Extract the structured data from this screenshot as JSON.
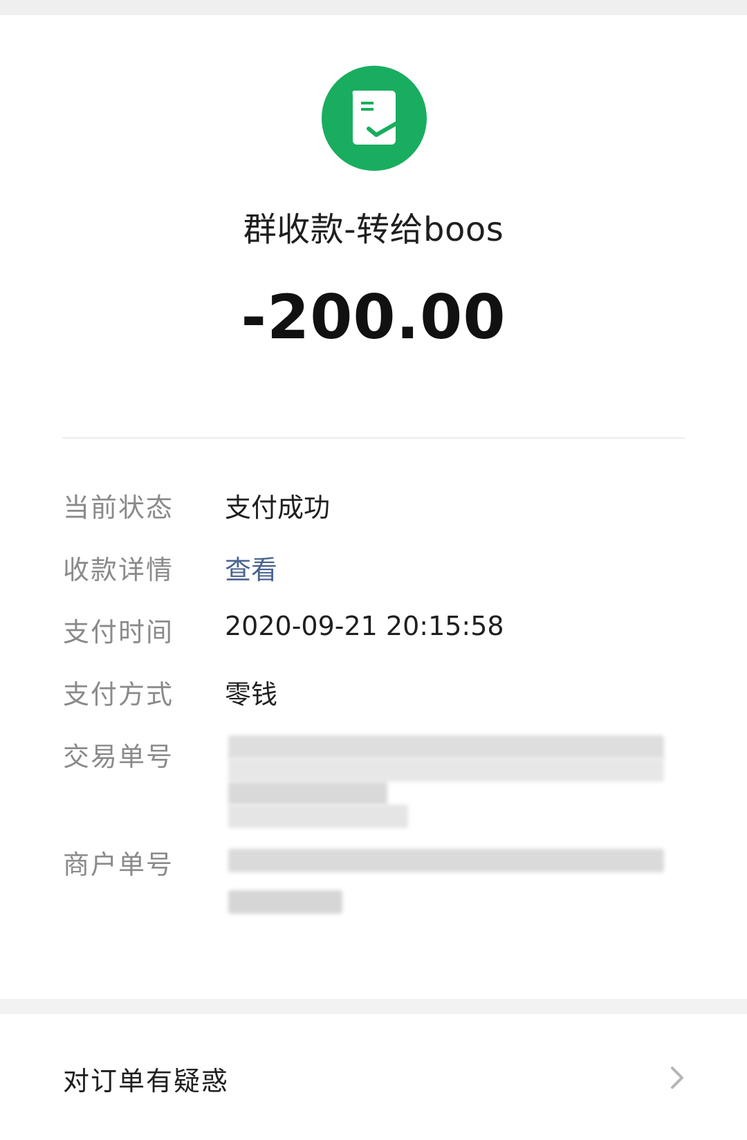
{
  "header": {
    "logo_icon": "receipt-check-icon",
    "brand_color": "#19ad5f",
    "payee": "群收款-转给boos",
    "amount": "-200.00"
  },
  "details": {
    "rows": [
      {
        "label": "当前状态",
        "value": "支付成功"
      },
      {
        "label": "收款详情",
        "value": "查看",
        "link_color": "#4a6490"
      },
      {
        "label": "支付时间",
        "value": "2020-09-21 20:15:58"
      },
      {
        "label": "支付方式",
        "value": "零钱"
      },
      {
        "label": "交易单号",
        "value_obscured": true
      },
      {
        "label": "商户单号",
        "value_obscured": true
      }
    ]
  },
  "footer": {
    "question": "对订单有疑惑",
    "chevron_icon": "chevron-right-icon"
  }
}
